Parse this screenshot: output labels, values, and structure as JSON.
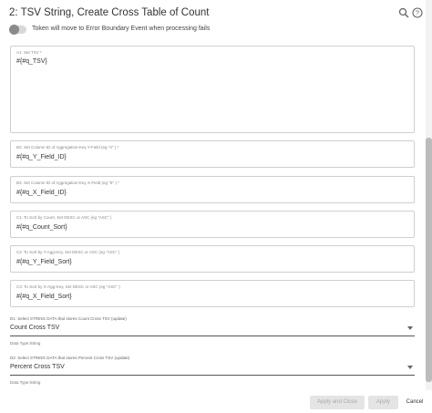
{
  "header": {
    "title": "2: TSV String, Create Cross Table of Count",
    "search_icon": "search-icon",
    "help_icon": "help-icon"
  },
  "toggle": {
    "label": "Token will move to Error Boundary Event when processing fails",
    "on": false
  },
  "fields": {
    "a1": {
      "label": "A1: Set TSV *",
      "value": "#{#q_TSV}"
    },
    "b2": {
      "label": "B2: Set Column ID of Aggregation-Key Y-Field (eg \"4\" ) *",
      "value": "#{#q_Y_Field_ID}"
    },
    "b3": {
      "label": "B3: Set Column ID of Aggregation-Key X-Field (eg \"5\" ) *",
      "value": "#{#q_X_Field_ID}"
    },
    "c1": {
      "label": "C1: To Sort by Count, Set DESC or ASC (eg \"ASC\" )",
      "value": "#{#q_Count_Sort}"
    },
    "c2": {
      "label": "C2: To Sort by Y-Agg-Key, Set DESC or ASC (eg \"ASC\" )",
      "value": "#{#q_Y_Field_Sort}"
    },
    "c3": {
      "label": "C3: To Sort by X-Agg-Key, Set DESC or ASC (eg \"ASC\" )",
      "value": "#{#q_X_Field_Sort}"
    }
  },
  "selects": {
    "d1": {
      "label": "D1: Select STRING DATA that stores Count Cross TSV (update)",
      "value": "Count Cross TSV",
      "hint": "Data Type:String"
    },
    "d2": {
      "label": "D2: Select STRING DATA that stores Percent Cross TSV (update)",
      "value": "Percent Cross TSV",
      "hint": "Data Type:String"
    }
  },
  "footer": {
    "apply_close_label": "Apply and Close",
    "apply_label": "Apply",
    "cancel_label": "Cancel"
  }
}
